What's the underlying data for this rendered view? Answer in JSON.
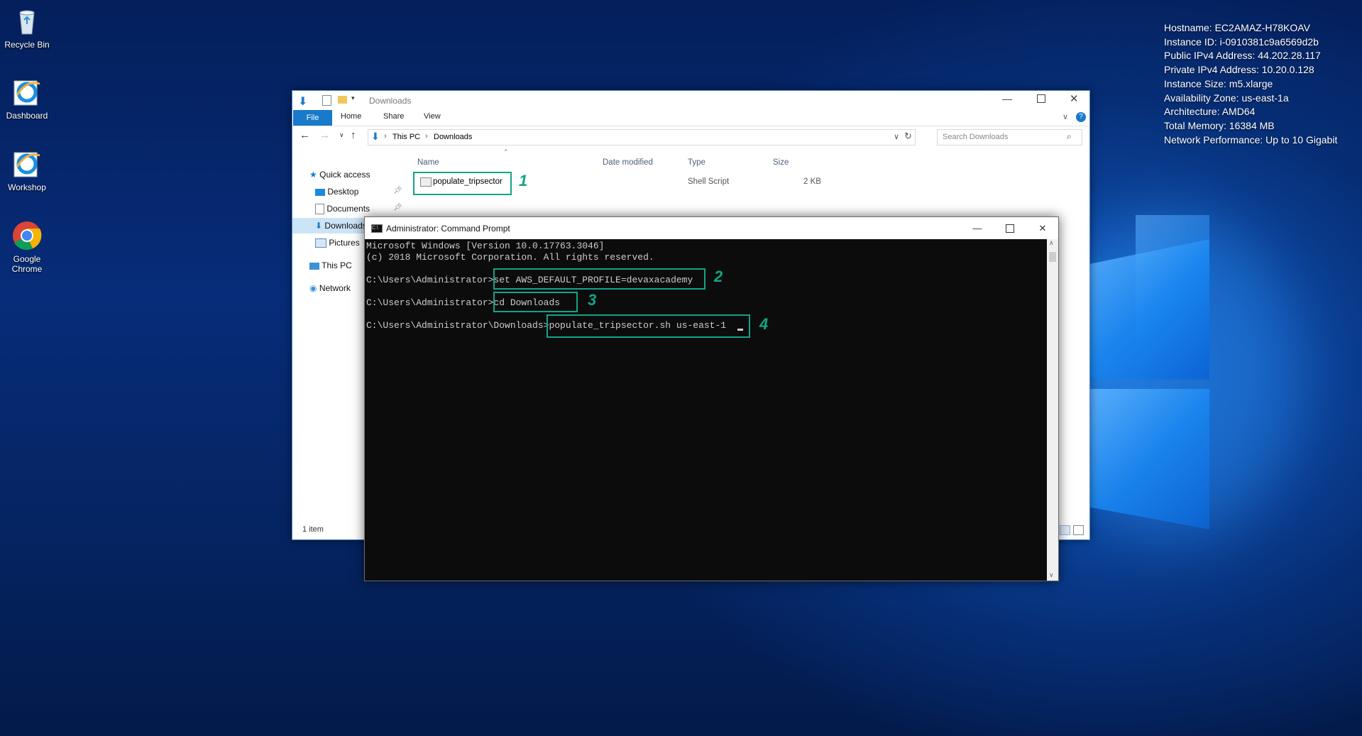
{
  "desktop": {
    "icons": [
      {
        "label": "Recycle Bin"
      },
      {
        "label": "Dashboard"
      },
      {
        "label": "Workshop"
      },
      {
        "label": "Google Chrome"
      }
    ],
    "sysinfo": [
      "Hostname: EC2AMAZ-H78KOAV",
      "Instance ID: i-0910381c9a6569d2b",
      "Public IPv4 Address: 44.202.28.117",
      "Private IPv4 Address: 10.20.0.128",
      "Instance Size: m5.xlarge",
      "Availability Zone: us-east-1a",
      "Architecture: AMD64",
      "Total Memory: 16384 MB",
      "Network Performance: Up to 10 Gigabit"
    ]
  },
  "explorer": {
    "title": "Downloads",
    "ribbon": {
      "file": "File",
      "home": "Home",
      "share": "Share",
      "view": "View"
    },
    "address": {
      "thispc": "This PC",
      "current": "Downloads"
    },
    "search_placeholder": "Search Downloads",
    "nav": {
      "quick_access": "Quick access",
      "desktop": "Desktop",
      "documents": "Documents",
      "downloads": "Downloads",
      "pictures": "Pictures",
      "this_pc": "This PC",
      "network": "Network"
    },
    "columns": {
      "name": "Name",
      "date": "Date modified",
      "type": "Type",
      "size": "Size"
    },
    "file": {
      "name": "populate_tripsector",
      "type": "Shell Script",
      "size": "2 KB"
    },
    "status": "1 item"
  },
  "cmd": {
    "title": "Administrator: Command Prompt",
    "lines": [
      "Microsoft Windows [Version 10.0.17763.3046]",
      "(c) 2018 Microsoft Corporation. All rights reserved.",
      "C:\\Users\\Administrator>set AWS_DEFAULT_PROFILE=devaxacademy",
      "C:\\Users\\Administrator>cd Downloads",
      "C:\\Users\\Administrator\\Downloads>populate_tripsector.sh us-east-1"
    ]
  },
  "annotations": [
    "1",
    "2",
    "3",
    "4"
  ],
  "colors": {
    "accent": "#12a486",
    "ribbon_file": "#1979ca"
  }
}
